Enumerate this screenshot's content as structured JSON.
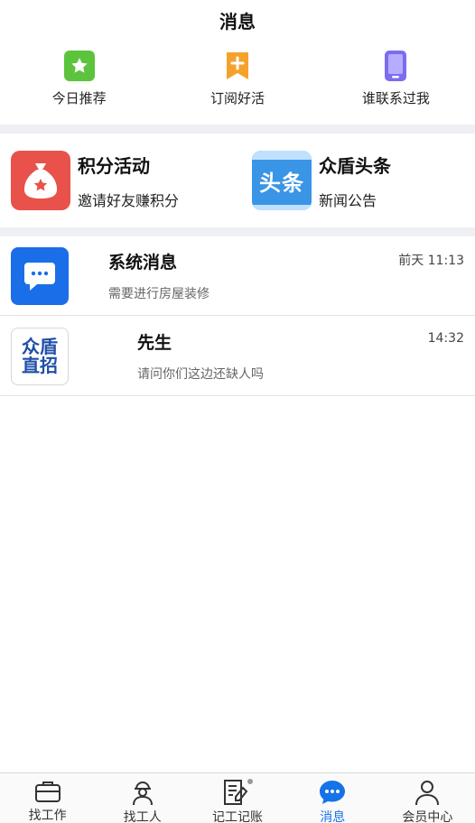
{
  "header": {
    "title": "消息"
  },
  "quick": [
    {
      "label": "今日推荐",
      "icon": "star-icon",
      "color": "#5cc43c"
    },
    {
      "label": "订阅好活",
      "icon": "bookmark-plus-icon",
      "color": "#f4a22c"
    },
    {
      "label": "谁联系过我",
      "icon": "phone-icon",
      "color": "#7b6cf0"
    }
  ],
  "features": [
    {
      "title": "积分活动",
      "subtitle": "邀请好友赚积分",
      "icon": "money-bag-icon",
      "color": "#e8524a"
    },
    {
      "title": "众盾头条",
      "subtitle": "新闻公告",
      "icon_text": "头条",
      "icon": "headline-icon",
      "color": "#3a95e6"
    }
  ],
  "messages": [
    {
      "name": "系统消息",
      "preview": "需要进行房屋装修",
      "time": "前天 11:13",
      "icon": "chat-bubble-icon",
      "color": "#1a6ee8"
    },
    {
      "name": "先生",
      "preview": "请问你们这边还缺人吗",
      "time": "14:32",
      "logo_line1": "众盾",
      "logo_line2": "直招",
      "icon": "company-logo",
      "color": "#1f4fa8"
    }
  ],
  "nav": [
    {
      "label": "找工作",
      "icon": "briefcase-icon"
    },
    {
      "label": "找工人",
      "icon": "worker-icon"
    },
    {
      "label": "记工记账",
      "icon": "note-pen-icon"
    },
    {
      "label": "消息",
      "icon": "message-icon",
      "active": true
    },
    {
      "label": "会员中心",
      "icon": "user-icon"
    }
  ],
  "colors": {
    "accent": "#1672e8",
    "divider": "#eef0f3"
  }
}
